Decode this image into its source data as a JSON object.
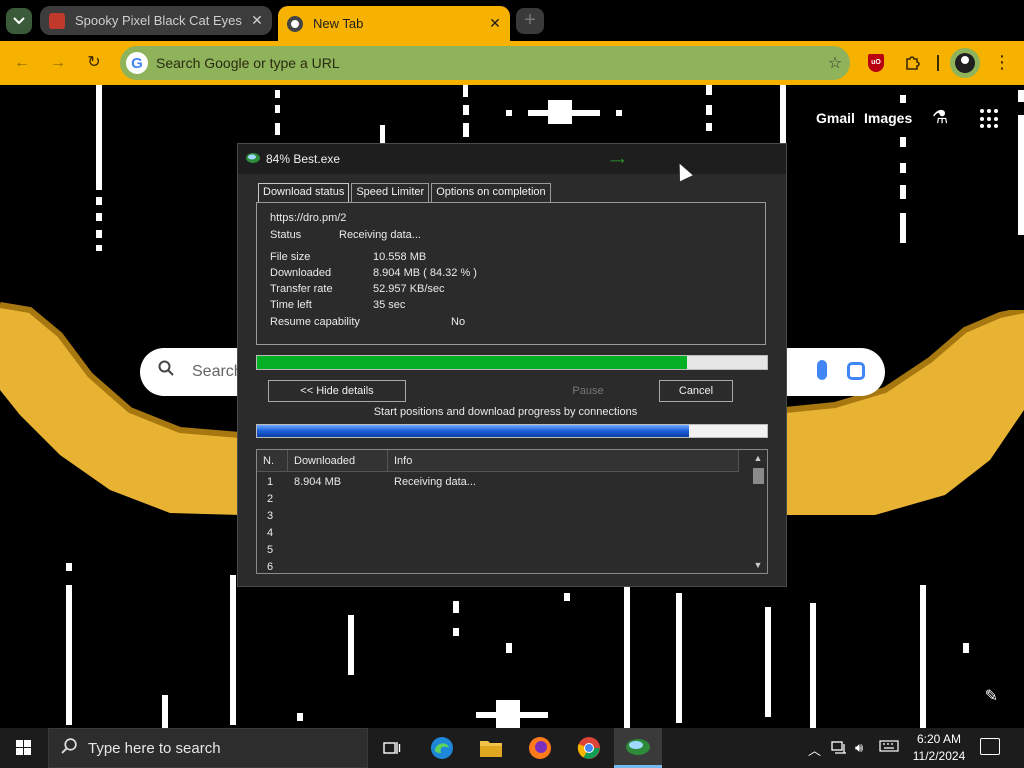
{
  "browser": {
    "tabs": [
      {
        "title": "Spooky Pixel Black Cat Eyes - C",
        "close": "✕"
      },
      {
        "title": "New Tab",
        "close": "✕"
      }
    ],
    "new_tab": "+",
    "omnibox_placeholder": "Search Google or type a URL",
    "google_g": "G",
    "ublock_label": "uO",
    "colors": {
      "accent": "#f7b200",
      "omnibox": "#8fb35b",
      "tab_inactive": "#3c3c3c"
    }
  },
  "newtab": {
    "gmail": "Gmail",
    "images": "Images",
    "search_placeholder": "Search"
  },
  "dialog": {
    "title": "84% Best.exe",
    "tabs": [
      "Download status",
      "Speed Limiter",
      "Options on completion"
    ],
    "url": "https://dro.pm/2",
    "status_label": "Status",
    "status_value": "Receiving data...",
    "file_size_label": "File size",
    "file_size_value": "10.558  MB",
    "downloaded_label": "Downloaded",
    "downloaded_value": "8.904  MB  ( 84.32 % )",
    "transfer_rate_label": "Transfer rate",
    "transfer_rate_value": "52.957  KB/sec",
    "time_left_label": "Time left",
    "time_left_value": "35 sec",
    "resume_label": "Resume capability",
    "resume_value": "No",
    "progress_fraction": 0.8432,
    "connection_progress_fraction": 0.847,
    "hide_details": "<< Hide details",
    "pause": "Pause",
    "cancel": "Cancel",
    "connections_caption": "Start positions and download progress by connections",
    "columns": [
      "N.",
      "Downloaded",
      "Info"
    ],
    "rows": [
      {
        "n": "1",
        "downloaded": "8.904  MB",
        "info": "Receiving data..."
      },
      {
        "n": "2",
        "downloaded": "",
        "info": ""
      },
      {
        "n": "3",
        "downloaded": "",
        "info": ""
      },
      {
        "n": "4",
        "downloaded": "",
        "info": ""
      },
      {
        "n": "5",
        "downloaded": "",
        "info": ""
      },
      {
        "n": "6",
        "downloaded": "",
        "info": ""
      }
    ],
    "colors": {
      "progress": "#06b025",
      "connection_bar": "#1c5fd8"
    }
  },
  "taskbar": {
    "search_placeholder": "Type here to search",
    "time": "6:20 AM",
    "date": "11/2/2024",
    "pinned": [
      "task-view-icon",
      "edge-icon",
      "file-explorer-icon",
      "firefox-icon",
      "chrome-icon",
      "idm-icon"
    ]
  }
}
